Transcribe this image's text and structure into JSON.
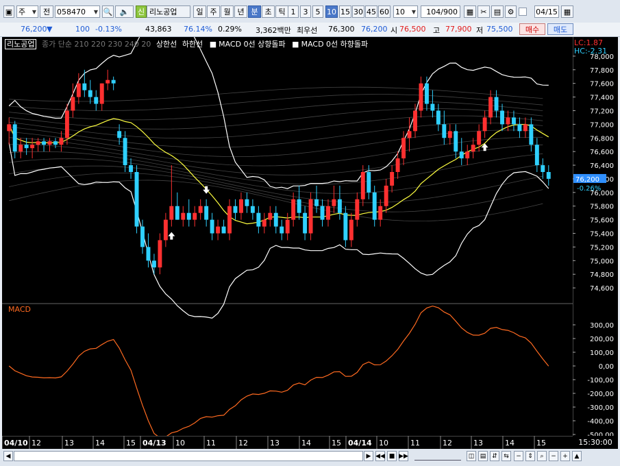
{
  "toolbar": {
    "market": "주",
    "market_arrow": "▼",
    "prev_label": "전",
    "code": "058470",
    "code_arrow": "▼",
    "credit_badge": "신",
    "stock_name": "리노공업",
    "periods": [
      "일",
      "주",
      "월",
      "년",
      "분",
      "초",
      "틱"
    ],
    "active_period": "분",
    "minutes": [
      "1",
      "3",
      "5",
      "10",
      "15",
      "30",
      "45",
      "60"
    ],
    "active_minute": "10",
    "custom_minute": "10",
    "count": "104/900",
    "date": "04/15"
  },
  "info": {
    "price": "76,200",
    "change_arrow": "▼",
    "change": "100",
    "change_rate": "-0.13%",
    "volume": "43,863",
    "volume_ratio": "76.14%",
    "turnover_rate": "0.29%",
    "amount": "3,362백만",
    "best_ask_label": "최우선",
    "best_ask": "76,300",
    "best_bid": "76,200",
    "open_label": "시",
    "open": "76,500",
    "high_label": "고",
    "high": "77,900",
    "low_label": "저",
    "low": "75,500",
    "buy_label": "매수",
    "sell_label": "매도"
  },
  "legend": {
    "stock": "리노공업",
    "ma": "종가 단순 210 220 230 240 20",
    "upper": "상한선",
    "lower": "하한선",
    "macd_up": "MACD 0선 상향돌파",
    "macd_down": "MACD 0선 하향돌파",
    "lc": "LC:1.87",
    "hc": "HC:-2.31",
    "macd_title": "MACD"
  },
  "price_axis": [
    "78,000",
    "77,800",
    "77,600",
    "77,400",
    "77,200",
    "77,000",
    "76,800",
    "76,600",
    "76,400",
    "76,200",
    "76,000",
    "75,800",
    "75,600",
    "75,400",
    "75,200",
    "75,000",
    "74,800",
    "74,600"
  ],
  "current_price_tag": "76,200",
  "current_rate_tag": "-0.26%",
  "macd_axis": [
    "300,00",
    "200,00",
    "100,00",
    "0,00",
    "-100,00",
    "-200,00",
    "-300,00",
    "-400,00",
    "-500,00"
  ],
  "time_axis": [
    {
      "label": "04/10",
      "bold": true
    },
    {
      "label": "12"
    },
    {
      "label": "13"
    },
    {
      "label": "14"
    },
    {
      "label": "15"
    },
    {
      "label": "04/13",
      "bold": true
    },
    {
      "label": "10"
    },
    {
      "label": "11"
    },
    {
      "label": "12"
    },
    {
      "label": "13"
    },
    {
      "label": "14"
    },
    {
      "label": "15"
    },
    {
      "label": "04/14",
      "bold": true
    },
    {
      "label": "10"
    },
    {
      "label": "11"
    },
    {
      "label": "12"
    },
    {
      "label": "13"
    },
    {
      "label": "14"
    },
    {
      "label": "15"
    }
  ],
  "clock": "15:30:00",
  "colors": {
    "up": "#ff3030",
    "down": "#2fd0ff",
    "ma": "#ffff40",
    "band": "#ffffff",
    "macd": "#ff6a20",
    "bg": "#000000"
  },
  "chart_data": {
    "type": "candlestick",
    "candles": [
      [
        76900,
        77100,
        76700,
        77000
      ],
      [
        77000,
        77050,
        76500,
        76600
      ],
      [
        76600,
        76800,
        76500,
        76700
      ],
      [
        76700,
        76800,
        76550,
        76650
      ],
      [
        76650,
        76800,
        76500,
        76700
      ],
      [
        76700,
        76800,
        76600,
        76750
      ],
      [
        76750,
        76800,
        76600,
        76700
      ],
      [
        76700,
        76800,
        76600,
        76750
      ],
      [
        76750,
        76800,
        76650,
        76700
      ],
      [
        76700,
        76900,
        76600,
        76800
      ],
      [
        76800,
        77300,
        76700,
        77200
      ],
      [
        77200,
        77600,
        77100,
        77400
      ],
      [
        77400,
        77750,
        77300,
        77600
      ],
      [
        77600,
        77800,
        77400,
        77500
      ],
      [
        77500,
        77650,
        77300,
        77400
      ],
      [
        77400,
        77500,
        77200,
        77300
      ],
      [
        77300,
        77600,
        77200,
        77600
      ],
      [
        77600,
        77800,
        77500,
        77650
      ],
      [
        77650,
        77700,
        77500,
        77600
      ],
      [
        76900,
        77000,
        76700,
        76800
      ],
      [
        76800,
        76900,
        76300,
        76400
      ],
      [
        76400,
        76500,
        76200,
        76300
      ],
      [
        76300,
        76400,
        75400,
        75500
      ],
      [
        75500,
        75600,
        75100,
        75200
      ],
      [
        75200,
        75400,
        74900,
        75000
      ],
      [
        75000,
        75100,
        74800,
        74900
      ],
      [
        74900,
        75400,
        74800,
        75300
      ],
      [
        75300,
        75700,
        75200,
        75600
      ],
      [
        75600,
        76400,
        75500,
        75800
      ],
      [
        75800,
        76000,
        75600,
        75600
      ],
      [
        75600,
        75800,
        75500,
        75700
      ],
      [
        75700,
        75900,
        75500,
        75600
      ],
      [
        75600,
        75800,
        75500,
        75700
      ],
      [
        75700,
        75900,
        75600,
        75800
      ],
      [
        75800,
        75900,
        75500,
        75600
      ],
      [
        75600,
        75700,
        75300,
        75400
      ],
      [
        75400,
        75600,
        75300,
        75500
      ],
      [
        75500,
        75600,
        75400,
        75400
      ],
      [
        75400,
        75900,
        75300,
        75800
      ],
      [
        75800,
        75900,
        75600,
        75700
      ],
      [
        75700,
        76000,
        75600,
        75900
      ],
      [
        75900,
        76000,
        75700,
        75800
      ],
      [
        75800,
        75900,
        75600,
        75700
      ],
      [
        75700,
        75800,
        75400,
        75500
      ],
      [
        75500,
        75700,
        75400,
        75600
      ],
      [
        75600,
        75800,
        75500,
        75700
      ],
      [
        75700,
        75800,
        75400,
        75500
      ],
      [
        75500,
        75600,
        75300,
        75400
      ],
      [
        75400,
        75700,
        75300,
        75600
      ],
      [
        75600,
        76000,
        75500,
        75900
      ],
      [
        75900,
        76100,
        75600,
        75700
      ],
      [
        75700,
        75800,
        75300,
        75400
      ],
      [
        75400,
        76000,
        75300,
        75900
      ],
      [
        75900,
        76100,
        75700,
        75800
      ],
      [
        75800,
        75900,
        75500,
        75600
      ],
      [
        75600,
        75900,
        75500,
        75800
      ],
      [
        75800,
        76100,
        75700,
        75900
      ],
      [
        75900,
        76100,
        75600,
        75700
      ],
      [
        75700,
        75800,
        75200,
        75300
      ],
      [
        75300,
        75700,
        75200,
        75600
      ],
      [
        75600,
        76000,
        75500,
        75900
      ],
      [
        75900,
        76400,
        75800,
        76300
      ],
      [
        76300,
        76400,
        75900,
        76000
      ],
      [
        76000,
        76100,
        75500,
        75600
      ],
      [
        75600,
        75900,
        75500,
        75800
      ],
      [
        75800,
        76200,
        75700,
        76100
      ],
      [
        76100,
        76400,
        76000,
        76300
      ],
      [
        76300,
        76600,
        76200,
        76500
      ],
      [
        76500,
        76900,
        76400,
        76800
      ],
      [
        76800,
        77100,
        76600,
        76900
      ],
      [
        76900,
        77300,
        76800,
        77200
      ],
      [
        77200,
        77700,
        77100,
        77600
      ],
      [
        77600,
        77700,
        77200,
        77300
      ],
      [
        77300,
        77500,
        77100,
        77200
      ],
      [
        77200,
        77300,
        76900,
        77000
      ],
      [
        77000,
        77200,
        76700,
        76800
      ],
      [
        76800,
        77000,
        76700,
        76900
      ],
      [
        76900,
        77000,
        76500,
        76600
      ],
      [
        76600,
        76800,
        76400,
        76500
      ],
      [
        76500,
        76700,
        76400,
        76600
      ],
      [
        76600,
        76800,
        76500,
        76700
      ],
      [
        76700,
        77000,
        76600,
        76900
      ],
      [
        76900,
        77200,
        76800,
        77100
      ],
      [
        77100,
        77500,
        77000,
        77400
      ],
      [
        77400,
        77500,
        77100,
        77200
      ],
      [
        77200,
        77300,
        76900,
        77000
      ],
      [
        77000,
        77200,
        76900,
        77100
      ],
      [
        77100,
        77200,
        76900,
        77000
      ],
      [
        77000,
        77100,
        76800,
        76900
      ],
      [
        76900,
        77100,
        76800,
        77000
      ],
      [
        77000,
        77100,
        76600,
        76700
      ],
      [
        76700,
        76800,
        76300,
        76400
      ],
      [
        76400,
        76500,
        76200,
        76300
      ],
      [
        76300,
        76400,
        76100,
        76200
      ]
    ],
    "macd_min": -500,
    "macd_max": 400,
    "price_min": 74400,
    "price_max": 78200
  }
}
